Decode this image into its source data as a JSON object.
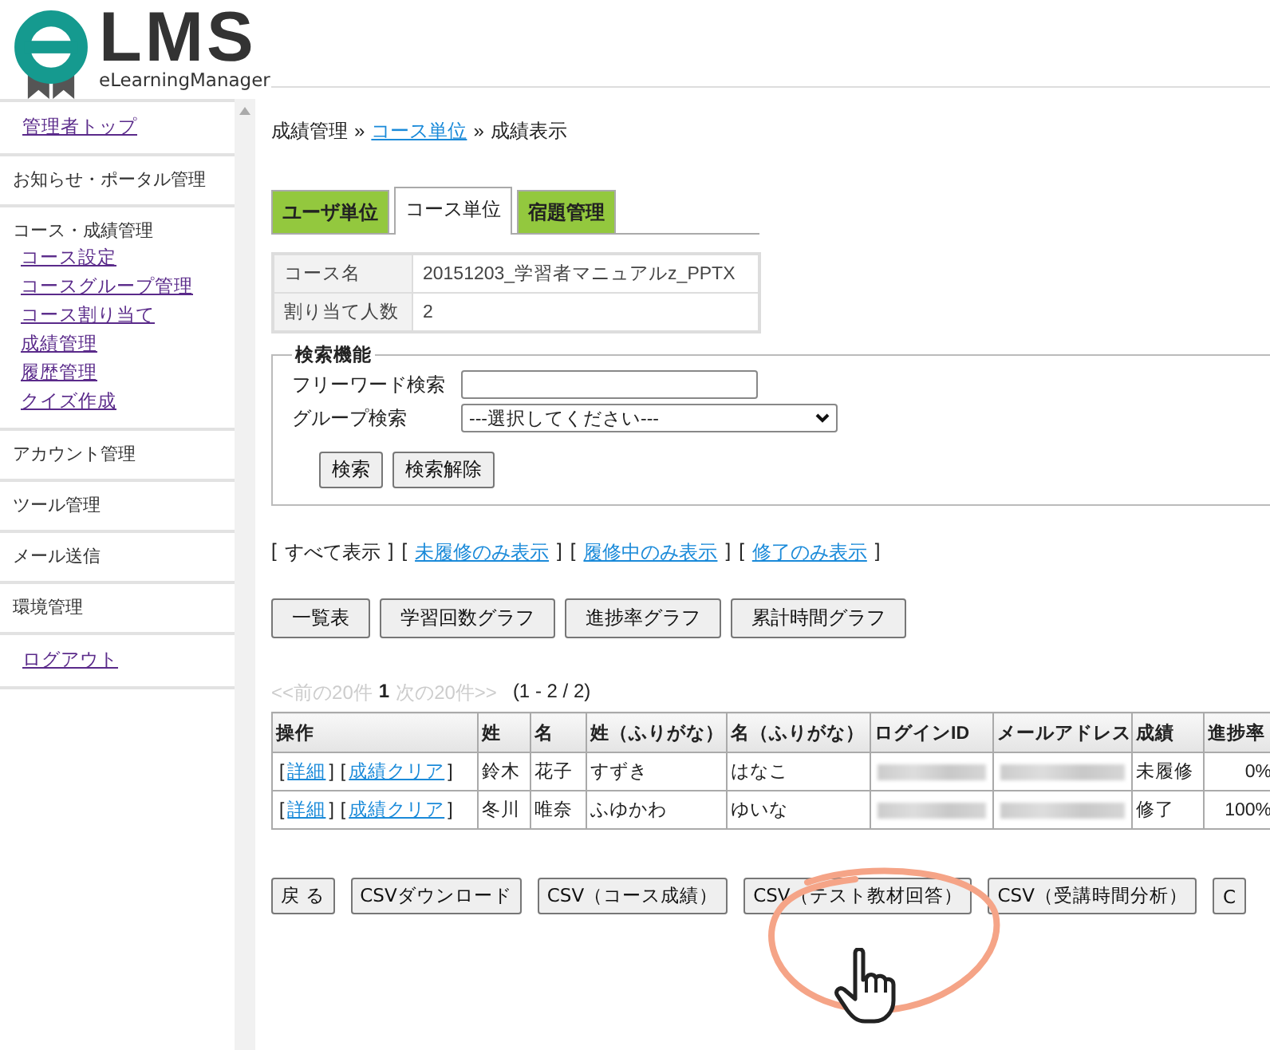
{
  "logo": {
    "title": "LMS",
    "subtitle": "eLearningManager"
  },
  "sidebar": [
    {
      "kind": "link",
      "label": "管理者トップ"
    },
    {
      "kind": "heading",
      "label": "お知らせ・ポータル管理"
    },
    {
      "kind": "group",
      "label": "コース・成績管理",
      "children": [
        {
          "label": "コース設定"
        },
        {
          "label": "コースグループ管理"
        },
        {
          "label": "コース割り当て"
        },
        {
          "label": "成績管理"
        },
        {
          "label": "履歴管理"
        },
        {
          "label": "クイズ作成"
        }
      ]
    },
    {
      "kind": "heading",
      "label": "アカウント管理"
    },
    {
      "kind": "heading",
      "label": "ツール管理"
    },
    {
      "kind": "heading",
      "label": "メール送信"
    },
    {
      "kind": "heading",
      "label": "環境管理"
    },
    {
      "kind": "link",
      "label": "ログアウト"
    }
  ],
  "breadcrumb": [
    {
      "label": "成績管理",
      "link": false
    },
    {
      "label": "»",
      "link": false
    },
    {
      "label": "コース単位",
      "link": true
    },
    {
      "label": "»",
      "link": false
    },
    {
      "label": "成績表示",
      "link": false
    }
  ],
  "tabs": [
    {
      "label": "ユーザ単位",
      "selected": false
    },
    {
      "label": "コース単位",
      "selected": true
    },
    {
      "label": "宿題管理",
      "selected": false
    }
  ],
  "course_info": [
    {
      "label": "コース名",
      "value": "20151203_学習者マニュアルz_PPTX"
    },
    {
      "label": "割り当て人数",
      "value": "2"
    }
  ],
  "search": {
    "legend": "検索機能",
    "fields": [
      {
        "kind": "text",
        "label": "フリーワード検索"
      },
      {
        "kind": "select",
        "label": "グループ検索",
        "value": "---選択してください---"
      }
    ],
    "buttons": [
      "検索",
      "検索解除"
    ]
  },
  "filters": [
    {
      "open": "[",
      "label": "すべて表示",
      "link": false,
      "close": "]"
    },
    {
      "open": "[",
      "label": "未履修のみ表示",
      "link": true,
      "close": "]"
    },
    {
      "open": "[",
      "label": "履修中のみ表示",
      "link": true,
      "close": "]"
    },
    {
      "open": "[",
      "label": "修了のみ表示",
      "link": true,
      "close": "]"
    }
  ],
  "view_buttons": [
    "一覧表",
    "学習回数グラフ",
    "進捗率グラフ",
    "累計時間グラフ"
  ],
  "pager": {
    "prev": "<<前の20件",
    "page": "1",
    "next": "次の20件>>",
    "range": "(1 - 2 / 2)"
  },
  "table": {
    "columns": [
      "操作",
      "姓",
      "名",
      "姓（ふりがな）",
      "名（ふりがな）",
      "ログインID",
      "メールアドレス",
      "成績",
      "進捗率"
    ],
    "rows": [
      {
        "cells": [
          {
            "kind": "actions",
            "actions": [
              {
                "open": "[",
                "label": "詳細",
                "close": "]"
              },
              {
                "open": "[",
                "label": "成績クリア",
                "close": "]"
              }
            ]
          },
          {
            "kind": "text",
            "text": "鈴木"
          },
          {
            "kind": "text",
            "text": "花子"
          },
          {
            "kind": "text",
            "text": "すずき"
          },
          {
            "kind": "text",
            "text": "はなこ"
          },
          {
            "kind": "redacted"
          },
          {
            "kind": "redacted"
          },
          {
            "kind": "text",
            "text": "未履修"
          },
          {
            "kind": "number",
            "text": "0%"
          }
        ]
      },
      {
        "cells": [
          {
            "kind": "actions",
            "actions": [
              {
                "open": "[",
                "label": "詳細",
                "close": "]"
              },
              {
                "open": "[",
                "label": "成績クリア",
                "close": "]"
              }
            ]
          },
          {
            "kind": "text",
            "text": "冬川"
          },
          {
            "kind": "text",
            "text": "唯奈"
          },
          {
            "kind": "text",
            "text": "ふゆかわ"
          },
          {
            "kind": "text",
            "text": "ゆいな"
          },
          {
            "kind": "redacted"
          },
          {
            "kind": "redacted"
          },
          {
            "kind": "text",
            "text": "修了"
          },
          {
            "kind": "number",
            "text": "100%"
          }
        ]
      }
    ]
  },
  "bottom_buttons": [
    "戻 る",
    "CSVダウンロード",
    "CSV（コース成績）",
    "CSV（テスト教材回答）",
    "CSV（受講時間分析）",
    "C"
  ]
}
